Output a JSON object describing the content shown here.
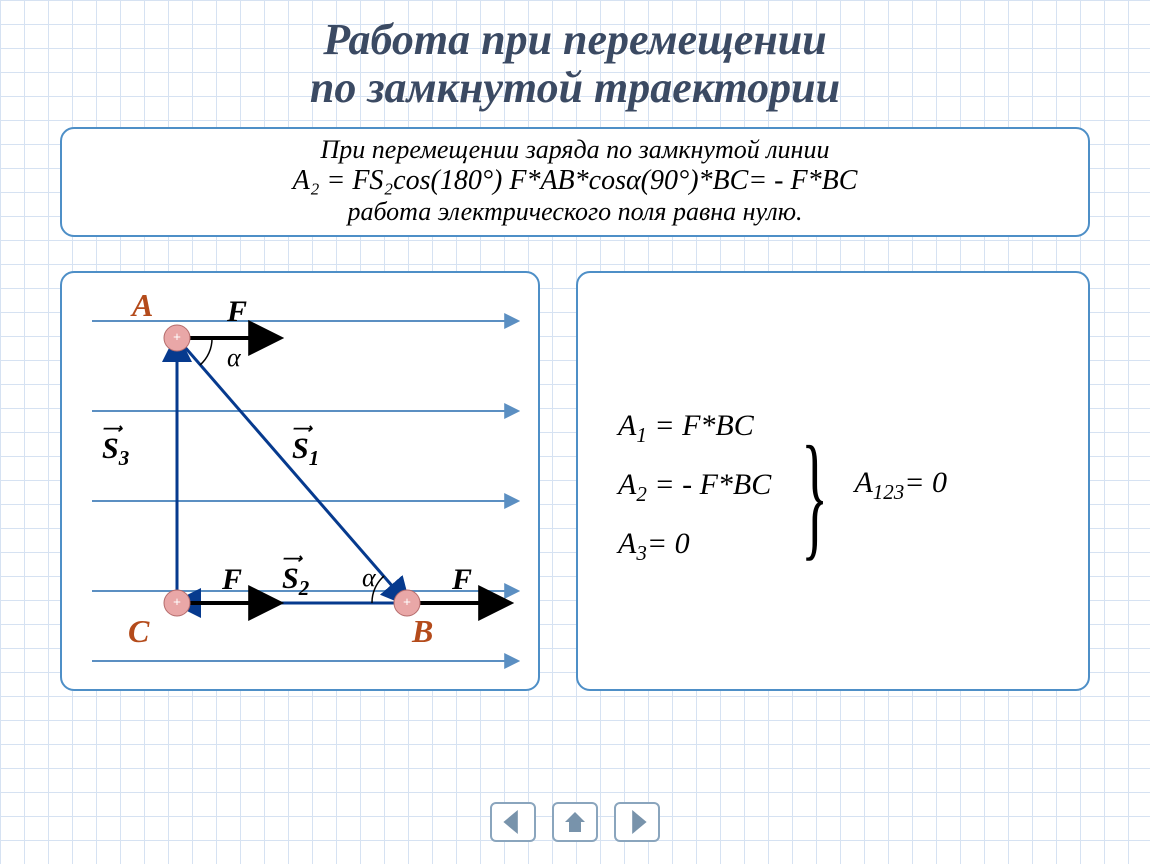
{
  "title_line1": "Работа при перемещении",
  "title_line2": "по замкнутой траектории",
  "top_text_1": "При перемещении заряда по замкнутой линии",
  "top_formula_overlap": "A₂ = FS₂cos(180°) F*AB*cosα(90°)*BC= - F*BC",
  "top_text_2": "работа электрического поля равна нулю.",
  "eq1_lhs": "A",
  "eq1_sub": "1",
  "eq1_rhs": " = F*BC",
  "eq2_lhs": "A",
  "eq2_sub": "2",
  "eq2_rhs": " = - F*BC",
  "eq3_lhs": "A",
  "eq3_sub": "3",
  "eq3_rhs": "= 0",
  "result_lhs": "A",
  "result_sub": "123",
  "result_rhs": "= 0",
  "points": {
    "A": "A",
    "B": "B",
    "C": "C"
  },
  "force": "F",
  "angle": "α",
  "vectors": {
    "S1": "S",
    "S1_sub": "1",
    "S2": "S",
    "S2_sub": "2",
    "S3": "S",
    "S3_sub": "3"
  },
  "nav": {
    "prev": "previous",
    "home": "home",
    "next": "next"
  }
}
